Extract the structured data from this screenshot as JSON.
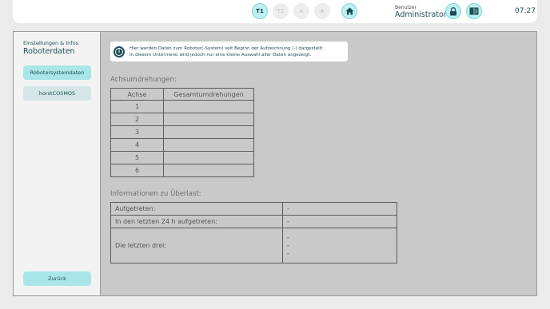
{
  "topbar": {
    "tool_buttons": [
      {
        "label": "T1",
        "active": true
      },
      {
        "label": "T2",
        "active": false
      },
      {
        "label": "A",
        "active": false
      },
      {
        "label": "★",
        "active": false
      }
    ],
    "user_label": "Benutzer",
    "user_name": "Administrator",
    "time": "07:27"
  },
  "sidebar": {
    "small_title": "Einstellungen & Infos",
    "title": "Roboterdaten",
    "items": [
      {
        "label": "Robotersystemdaten",
        "active": true
      },
      {
        "label": "horstCOSMOS",
        "active": false
      }
    ],
    "back_label": "Zurück"
  },
  "info": {
    "line1": "Hier werden Daten zum Roboter(-System) seit Beginn der Aufzeichnung (-) dargestellt.",
    "line2": "In diesem Untermenü wird jedoch nur eine kleine Auswahl aller Daten angezeigt."
  },
  "axes": {
    "title": "Achsumdrehungen:",
    "col_axis": "Achse",
    "col_total": "Gesamtumdrehungen",
    "rows": [
      {
        "axis": "1",
        "total": ""
      },
      {
        "axis": "2",
        "total": ""
      },
      {
        "axis": "3",
        "total": ""
      },
      {
        "axis": "4",
        "total": ""
      },
      {
        "axis": "5",
        "total": ""
      },
      {
        "axis": "6",
        "total": ""
      }
    ]
  },
  "overload": {
    "title": "Informationen zu Überlast:",
    "occurred_label": "Aufgetreten:",
    "occurred_value": "-",
    "last24_label": "In den letzten 24 h aufgetreten:",
    "last24_value": "-",
    "last3_label": "Die letzten drei:",
    "last3_values": [
      "-",
      "-",
      "-"
    ]
  },
  "colors": {
    "accent": "#a8e6e8",
    "text_dark": "#1d4d54",
    "content_bg": "#c9c9c9"
  }
}
